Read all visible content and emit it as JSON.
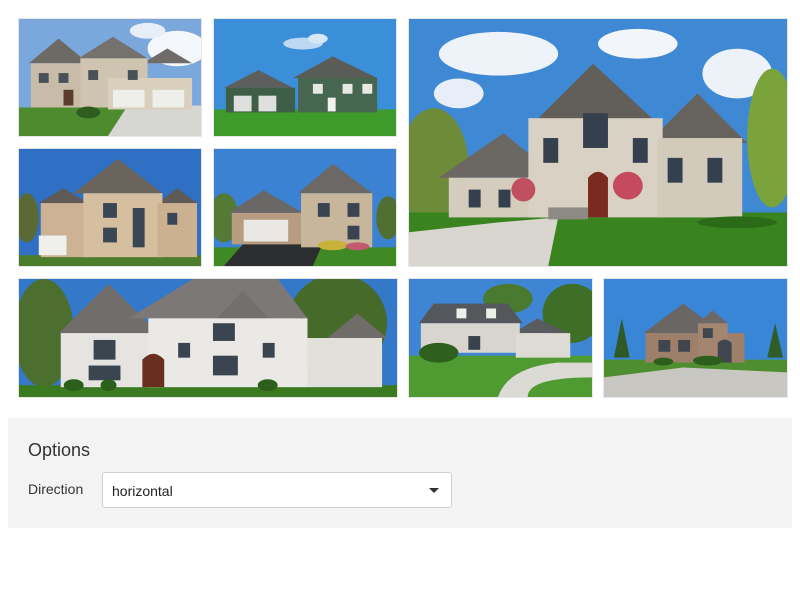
{
  "gallery": {
    "photos": [
      {
        "subject": "house-photo"
      },
      {
        "subject": "house-photo"
      },
      {
        "subject": "house-photo"
      },
      {
        "subject": "house-photo"
      },
      {
        "subject": "house-photo"
      },
      {
        "subject": "house-photo"
      },
      {
        "subject": "house-photo"
      },
      {
        "subject": "house-photo"
      }
    ]
  },
  "options": {
    "title": "Options",
    "direction_label": "Direction",
    "direction_value": "horizontal",
    "dropdown_icon": "caret-down-icon"
  }
}
